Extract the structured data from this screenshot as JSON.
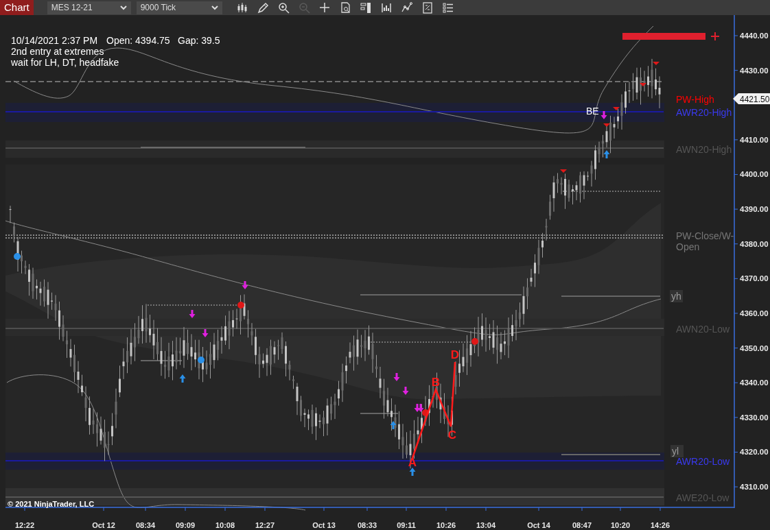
{
  "toolbar": {
    "title": "Chart",
    "instrument": "MES 12-21",
    "interval": "9000 Tick",
    "tools": [
      {
        "disabled": false
      },
      {
        "disabled": false
      },
      {
        "disabled": false
      },
      {
        "disabled": true
      },
      {
        "disabled": false
      },
      {
        "disabled": false
      },
      {
        "disabled": false
      },
      {
        "disabled": false
      },
      {
        "disabled": false
      },
      {
        "disabled": false
      },
      {
        "disabled": false
      }
    ]
  },
  "chart": {
    "header": [
      "10/14/2021 2:37 PM",
      "Open: 4394.75",
      "Gap: 39.5"
    ],
    "notes": [
      "2nd entry at extremes",
      "wait for LH, DT, headfake"
    ],
    "levels": [
      {
        "lines": [
          "PW-High"
        ],
        "color": "#ff0000"
      },
      {
        "lines": [
          "AWR20-High"
        ],
        "color": "#3a3af0"
      },
      {
        "lines": [
          "AWN20-High"
        ],
        "color": "#555555"
      },
      {
        "lines": [
          "PW-Close/W-",
          "Open"
        ],
        "color": "#777777"
      },
      {
        "lines": [
          "AWN20-Low"
        ],
        "color": "#555555"
      },
      {
        "lines": [
          "AWR20-Low"
        ],
        "color": "#3a3af0"
      },
      {
        "lines": [
          "AWE20-Low"
        ],
        "color": "#555555"
      }
    ],
    "tags": [
      "yh",
      "yl"
    ],
    "entry_label": "BE",
    "pattern": [
      "A",
      "B",
      "C",
      "D"
    ],
    "current_price": "4421.50",
    "price_axis": [
      "4440.00",
      "4430.00",
      "4410.00",
      "4400.00",
      "4390.00",
      "4380.00",
      "4370.00",
      "4360.00",
      "4350.00",
      "4340.00",
      "4330.00",
      "4320.00",
      "4310.00"
    ],
    "time_axis": [
      "12:22",
      "Oct 12",
      "08:34",
      "09:09",
      "10:08",
      "12:27",
      "Oct 13",
      "08:33",
      "09:11",
      "10:26",
      "13:04",
      "Oct 14",
      "08:47",
      "10:20",
      "14:26"
    ],
    "copyright": "© 2021 NinjaTrader, LLC"
  }
}
